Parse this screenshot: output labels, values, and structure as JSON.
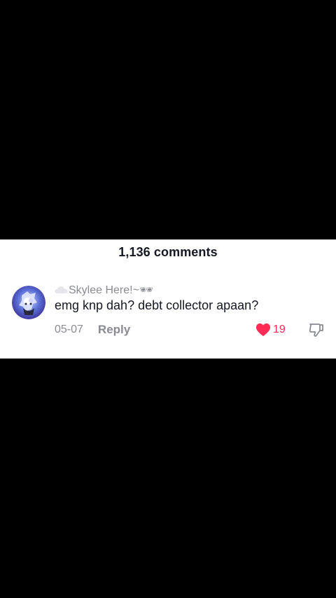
{
  "header": {
    "comments_count": "1,136 comments"
  },
  "comment": {
    "username": "Skylee Here!~🕶",
    "text": "emg knp dah? debt collector apaan?",
    "date": "05-07",
    "reply_label": "Reply",
    "like_count": "19",
    "liked": true,
    "icons": {
      "avatar": "avatar-image",
      "badge": "cloud-icon",
      "like": "heart-icon",
      "dislike": "thumbs-down-icon"
    }
  },
  "colors": {
    "like": "#fe2c55",
    "muted_text": "#8a8b91",
    "primary_text": "#161823",
    "background": "#ffffff",
    "letterbox": "#000000"
  }
}
